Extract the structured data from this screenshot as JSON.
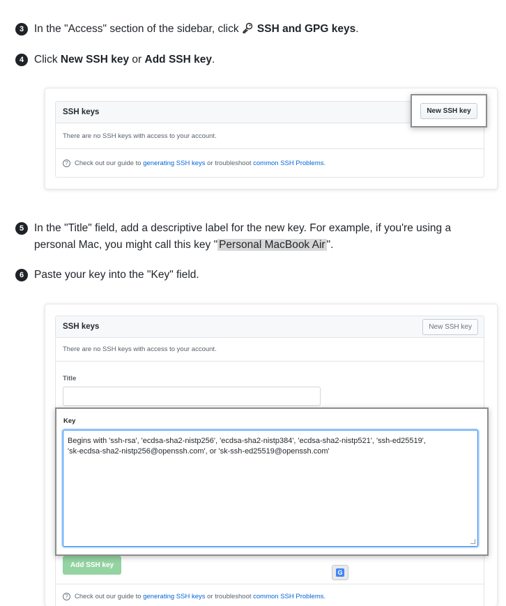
{
  "steps": [
    {
      "num": "3",
      "pre": "In the \"Access\" section of the sidebar, click",
      "bold": "SSH and GPG keys",
      "post": "."
    },
    {
      "num": "4",
      "pre": "Click ",
      "bold1": "New SSH key",
      "mid": " or ",
      "bold2": "Add SSH key",
      "post": "."
    },
    {
      "num": "5",
      "line1": "In the \"Title\" field, add a descriptive label for the new key. For example, if you're using a",
      "line2_pre": "personal Mac, you might call this key \"",
      "line2_hl": "Personal MacBook Air",
      "line2_post": "\"."
    },
    {
      "num": "6",
      "text": "Paste your key into the \"Key\" field."
    }
  ],
  "screenshot1": {
    "title": "SSH keys",
    "new_button": "New SSH key",
    "empty_text": "There are no SSH keys with access to your account.",
    "guide_pre": "Check out our guide to ",
    "guide_link1": "generating SSH keys",
    "guide_mid": " or troubleshoot ",
    "guide_link2": "common SSH Problems",
    "guide_post": "."
  },
  "screenshot2": {
    "title": "SSH keys",
    "new_button": "New SSH key",
    "empty_text": "There are no SSH keys with access to your account.",
    "title_label": "Title",
    "key_label": "Key",
    "key_placeholder_line1": "Begins with 'ssh-rsa', 'ecdsa-sha2-nistp256', 'ecdsa-sha2-nistp384', 'ecdsa-sha2-nistp521', 'ssh-ed25519',",
    "key_placeholder_line2": "'sk-ecdsa-sha2-nistp256@openssh.com', or 'sk-ssh-ed25519@openssh.com'",
    "add_button": "Add SSH key",
    "guide_pre": "Check out our guide to ",
    "guide_link1": "generating SSH keys",
    "guide_mid": " or troubleshoot ",
    "guide_link2": "common SSH Problems",
    "guide_post": "."
  },
  "icons": {
    "key": "key-icon",
    "help": "help-icon",
    "translate": "translate-icon"
  }
}
